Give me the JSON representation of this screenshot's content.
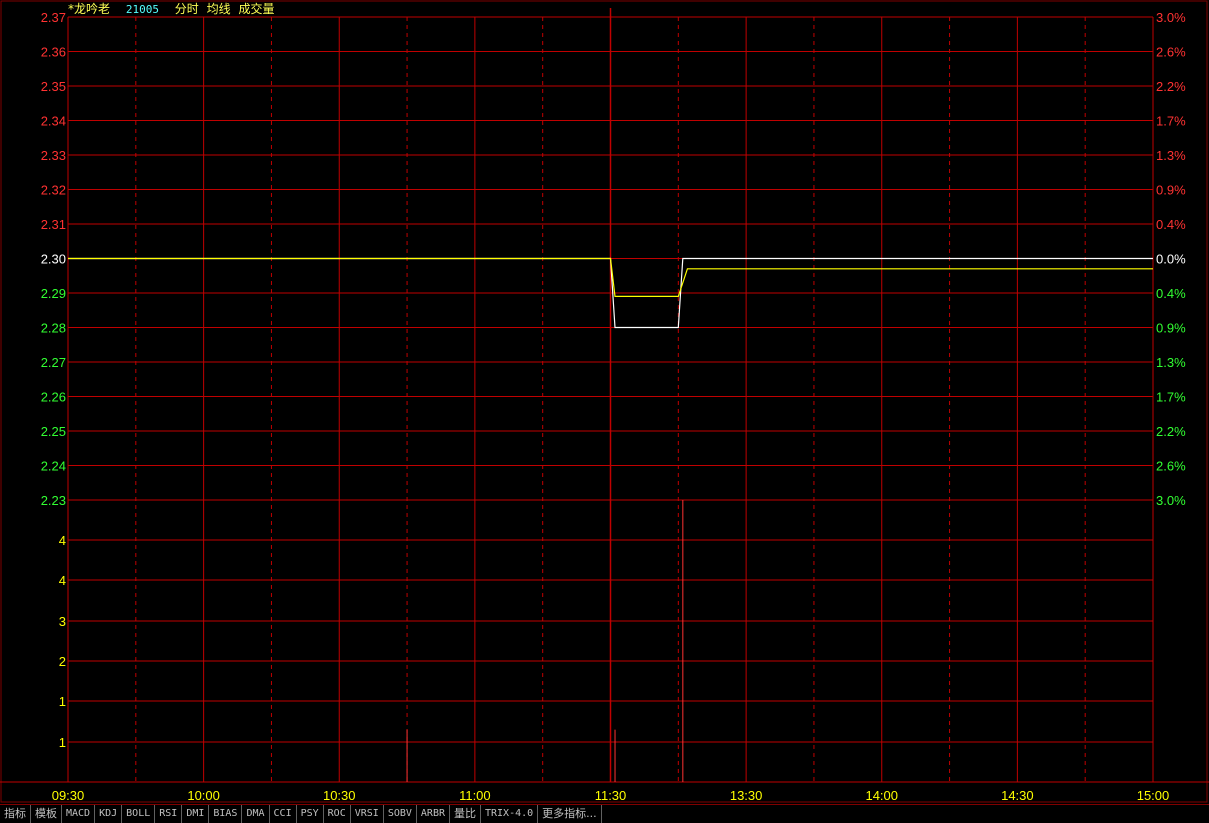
{
  "header": {
    "stock_name": "*龙吟老",
    "stock_code": "21005",
    "indicators": [
      "分时",
      "均线",
      "成交量"
    ]
  },
  "toolbar": {
    "tabs": [
      "指标",
      "模板",
      "MACD",
      "KDJ",
      "BOLL",
      "RSI",
      "DMI",
      "BIAS",
      "DMA",
      "CCI",
      "PSY",
      "ROC",
      "VRSI",
      "SOBV",
      "ARBR",
      "量比",
      "TRIX-4.0",
      "更多指标..."
    ]
  },
  "colors": {
    "background": "#000000",
    "grid": "#c00000",
    "price_up": "#ff3232",
    "price_down": "#32ff32",
    "price_flat": "#ffffff",
    "price_line": "#ffffff",
    "avg_line": "#ffff00",
    "volume_bar": "#ff3232",
    "volume_label": "#ffff00",
    "time_label": "#ffff00"
  },
  "chart_data": {
    "type": "line",
    "title": "",
    "x_ticks": [
      "09:30",
      "10:00",
      "10:30",
      "11:00",
      "11:30",
      "13:30",
      "14:00",
      "14:30",
      "15:00"
    ],
    "price_axis": {
      "ylim": [
        2.23,
        2.37
      ],
      "prev_close": 2.3,
      "ticks": [
        "2.37",
        "2.36",
        "2.35",
        "2.34",
        "2.33",
        "2.32",
        "2.31",
        "2.30",
        "2.29",
        "2.28",
        "2.27",
        "2.26",
        "2.25",
        "2.24",
        "2.23"
      ],
      "pct_ticks": [
        "3.0%",
        "2.6%",
        "2.2%",
        "1.7%",
        "1.3%",
        "0.9%",
        "0.4%",
        "0.0%",
        "0.4%",
        "0.9%",
        "1.3%",
        "1.7%",
        "2.2%",
        "2.6%",
        "3.0%"
      ]
    },
    "volume_axis": {
      "ticks": [
        "4",
        "4",
        "3",
        "2",
        "1",
        "1"
      ]
    },
    "series": [
      {
        "values_xy": [
          [
            "09:30",
            2.3
          ],
          [
            "11:30",
            2.3
          ],
          [
            "13:01",
            2.28
          ],
          [
            "13:15",
            2.28
          ],
          [
            "13:16",
            2.3
          ],
          [
            "15:00",
            2.3
          ]
        ]
      },
      {
        "values_xy": [
          [
            "09:30",
            2.3
          ],
          [
            "11:30",
            2.3
          ],
          [
            "13:01",
            2.289
          ],
          [
            "13:15",
            2.289
          ],
          [
            "13:17",
            2.297
          ],
          [
            "15:00",
            2.297
          ]
        ]
      }
    ],
    "volume": [
      {
        "time": "10:45",
        "value": 1.3
      },
      {
        "time": "13:01",
        "value": 1.3
      },
      {
        "time": "13:16",
        "value": 7.0
      }
    ]
  }
}
